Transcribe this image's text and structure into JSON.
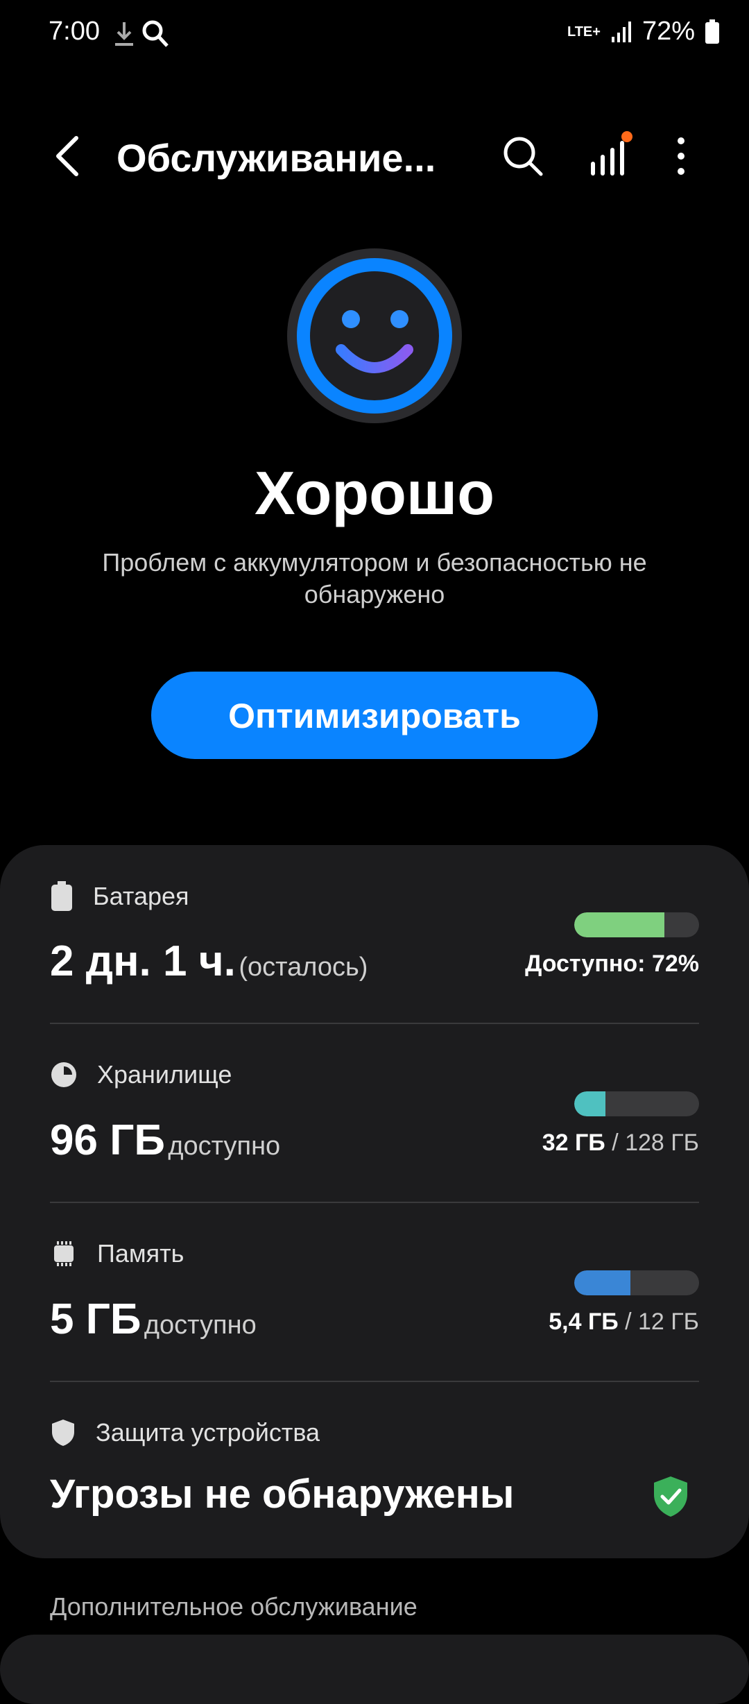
{
  "status_bar": {
    "time": "7:00",
    "network": "LTE+",
    "battery": "72%"
  },
  "header": {
    "title": "Обслуживание..."
  },
  "icons": {
    "back": "chevron-left-icon",
    "search": "search-icon",
    "stats": "bar-chart-icon",
    "more": "more-vertical-icon",
    "face": "smiley-face-icon"
  },
  "status": {
    "title": "Хорошо",
    "description": "Проблем с аккумулятором и безопасностью не обнаружено"
  },
  "optimize_button": {
    "label": "Оптимизировать"
  },
  "sections": {
    "battery": {
      "label": "Батарея",
      "value": "2 дн. 1 ч.",
      "suffix": "(осталось)",
      "caption_bold": "Доступно: 72%",
      "caption_rest": "",
      "fill": 0.72,
      "color": "#7fd07f"
    },
    "storage": {
      "label": "Хранилище",
      "value": "96 ГБ",
      "suffix": "доступно",
      "caption_bold": "32 ГБ",
      "caption_rest": " / 128 ГБ",
      "fill": 0.25,
      "color": "#4fc1c0"
    },
    "memory": {
      "label": "Память",
      "value": "5 ГБ",
      "suffix": "доступно",
      "caption_bold": "5,4 ГБ",
      "caption_rest": " / 12 ГБ",
      "fill": 0.45,
      "color": "#3a86d6"
    },
    "protection": {
      "label": "Защита устройства",
      "value": "Угрозы не обнаружены",
      "shield_color": "#3bb05a"
    }
  },
  "additional": {
    "label": "Дополнительное обслуживание"
  },
  "colors": {
    "accent": "#0a84ff",
    "card": "#1c1c1e"
  }
}
